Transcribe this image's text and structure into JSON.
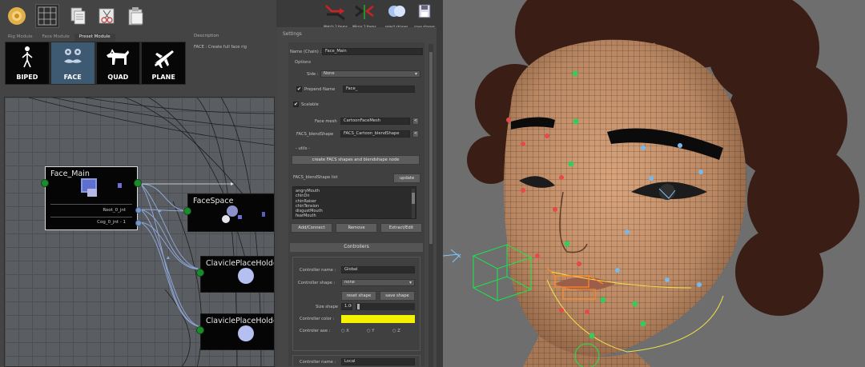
{
  "toolbar": {
    "icons": [
      "sun-icon",
      "grid-icon",
      "copy-icon",
      "mirror-icon",
      "paste-icon"
    ]
  },
  "module_tabs": [
    "Rig Module",
    "Face Module",
    "Preset Module"
  ],
  "presets": [
    {
      "label": "BIPED",
      "icon": "biped-icon"
    },
    {
      "label": "FACE",
      "icon": "face-icon"
    },
    {
      "label": "QUAD",
      "icon": "quad-icon"
    },
    {
      "label": "PLANE",
      "icon": "plane-icon"
    }
  ],
  "description": {
    "title": "Description",
    "text": "FACE : Create full face rig"
  },
  "top_actions": [
    {
      "label": "Match 2 Items",
      "icon": "match-icon"
    },
    {
      "label": "Mirror 2 Items",
      "icon": "mirror-items-icon"
    },
    {
      "label": "select shapes",
      "icon": "select-shapes-icon"
    },
    {
      "label": "save shapes",
      "icon": "save-shapes-icon"
    }
  ],
  "graph": {
    "nodes": [
      {
        "title": "Face_Main",
        "rows": [
          "Root_0_jnt",
          "Cog_0_jnt - 1"
        ]
      },
      {
        "title": "FaceSpace"
      },
      {
        "title": "ClaviclePlaceHolde"
      },
      {
        "title": "ClaviclePlaceHolde"
      }
    ]
  },
  "settings": {
    "title": "Settings",
    "name_label": "Name (Chain) :",
    "name_value": "Face_Main",
    "options_label": "Options",
    "side_label": "Side :",
    "side_value": "None",
    "prepend_label": "Prepend Name",
    "prepend_value": "Face_",
    "scalable_label": "Scalable",
    "face_mesh_label": "Face mesh",
    "face_mesh_value": "CartoonFaceMesh",
    "facs_label": "FACS_blendShape",
    "facs_value": "FACS_Cartoon_blendShape",
    "small_btn": "<",
    "utils_label": "- utils -",
    "create_btn": "create FACS shapes and blendshape node",
    "list_label": "FACS_blendShape list",
    "update_btn": "update",
    "blend_items": [
      "angryMouth",
      "chinDn",
      "chinRaiser",
      "chinTension",
      "disgustMouth",
      "fearMouth"
    ],
    "add_btn": "Add/Connect",
    "remove_btn": "Remove",
    "extract_btn": "Extract/Edit",
    "controllers_label": "Controllers",
    "ctrl_name_label": "Controller name :",
    "ctrl_name_value": "Global",
    "ctrl_shape_label": "Controller shape :",
    "ctrl_shape_value": "none",
    "reset_btn": "reset shape",
    "save_btn": "save shape",
    "size_label": "Size shape",
    "size_value": "1.00",
    "color_label": "Controller color :",
    "color_value": "#f5f200",
    "axis_label": "Controler axe :",
    "axis_x": "X",
    "axis_y": "Y",
    "axis_z": "Z",
    "ctrl_name_label2": "Controller name :",
    "ctrl_name_value2": "Local"
  }
}
